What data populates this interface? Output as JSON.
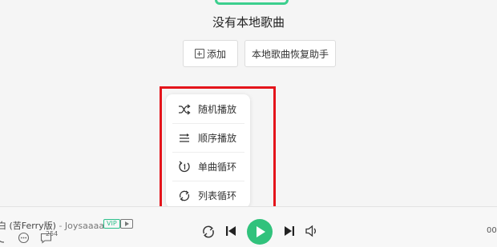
{
  "empty_state": {
    "title": "没有本地歌曲",
    "add_button": "添加",
    "restore_button": "本地歌曲恢复助手"
  },
  "play_mode_menu": {
    "items": [
      {
        "label": "随机播放",
        "icon": "shuffle-icon"
      },
      {
        "label": "顺序播放",
        "icon": "sequential-icon"
      },
      {
        "label": "单曲循环",
        "icon": "repeat-one-icon"
      },
      {
        "label": "列表循环",
        "icon": "repeat-list-icon"
      }
    ],
    "highlight_color": "#e4141b"
  },
  "player": {
    "song_title": "白 (苦Ferry版)",
    "separator": "-",
    "artist": "Joysaaaa",
    "vip_badge": "VIP",
    "comment_count": "254",
    "time": "00",
    "accent_color": "#31c27c"
  }
}
